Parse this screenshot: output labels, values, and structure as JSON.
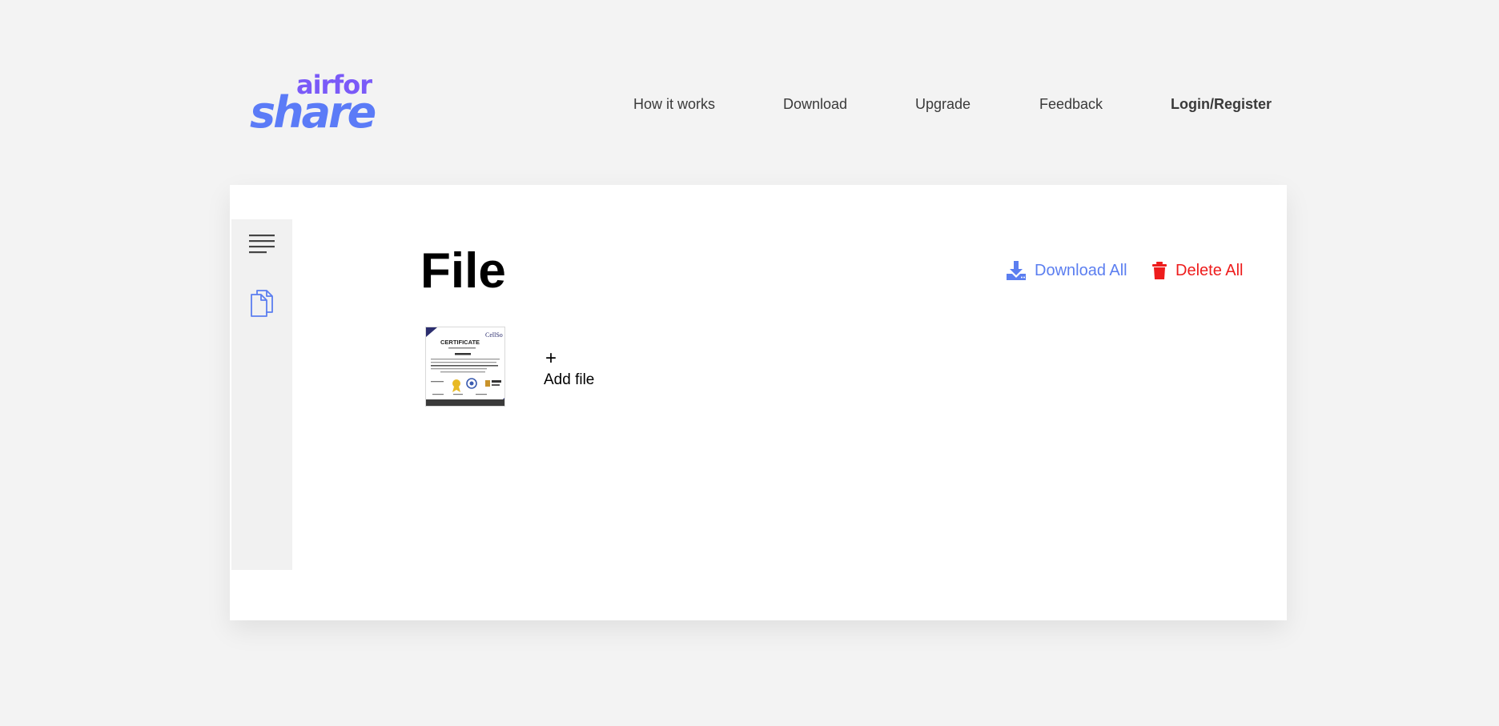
{
  "brand": {
    "logo_top": "airfor",
    "logo_bottom": "share",
    "colors": {
      "primary": "#5b7bf7",
      "secondary": "#7a5af8"
    }
  },
  "nav": {
    "how_it_works": "How it works",
    "download": "Download",
    "upgrade": "Upgrade",
    "feedback": "Feedback",
    "login_register": "Login/Register"
  },
  "sidebar": {
    "items": [
      {
        "icon": "menu-icon"
      },
      {
        "icon": "files-icon",
        "color": "#5b7ef0"
      }
    ]
  },
  "main": {
    "title": "File",
    "actions": {
      "download_all": "Download All",
      "delete_all": "Delete All",
      "download_color": "#5b7ef0",
      "delete_color": "#ee1c1c"
    },
    "files": [
      {
        "thumbnail_heading": "CERTIFICATE",
        "thumbnail_brand": "CellSo"
      }
    ],
    "add_file": {
      "icon": "+",
      "label": "Add file"
    }
  }
}
